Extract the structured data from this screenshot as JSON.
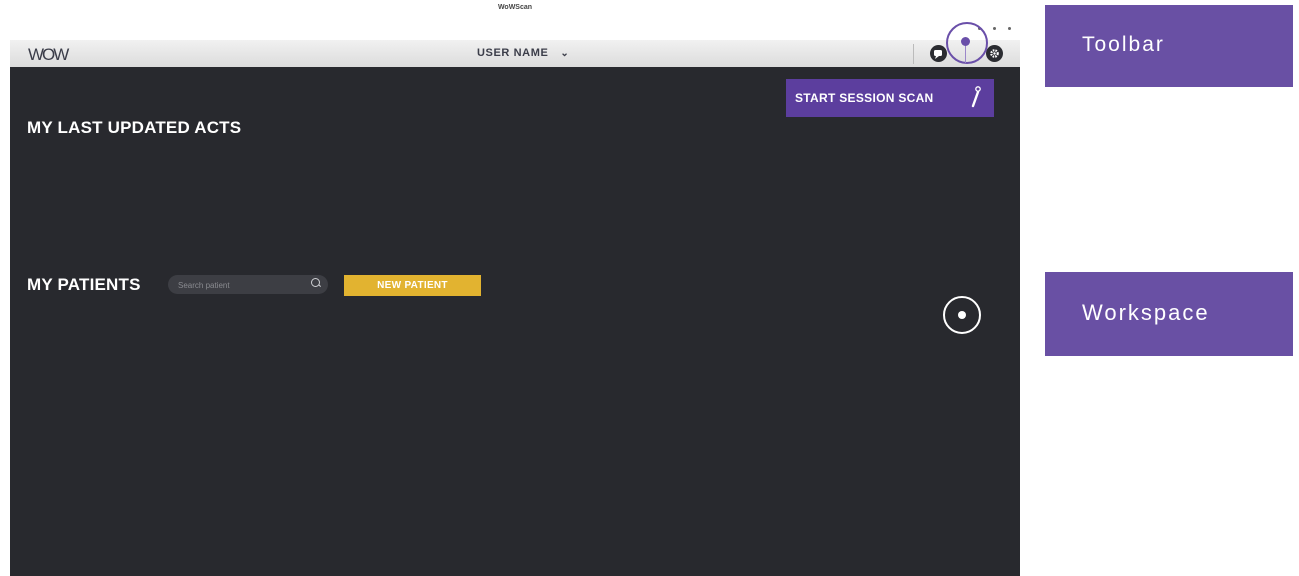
{
  "window": {
    "title": "WoWScan"
  },
  "toolbar": {
    "logo": "WOW",
    "user_name": "USER NAME",
    "user_chevron": "⌄",
    "icons": [
      "chat-icon",
      "gear-icon"
    ]
  },
  "workspace": {
    "start_session_scan": "START SESSION SCAN",
    "last_acts_title": "MY LAST UPDATED ACTS",
    "patients_title": "MY PATIENTS",
    "search_placeholder": "Search patient",
    "new_patient": "NEW PATIENT"
  },
  "annotations": {
    "toolbar": "Toolbar",
    "workspace": "Workspace"
  },
  "colors": {
    "workspace_bg": "#28292e",
    "accent_purple": "#5c3e9e",
    "new_patient_yellow": "#e2b330",
    "annotation_purple": "#6950a4"
  }
}
